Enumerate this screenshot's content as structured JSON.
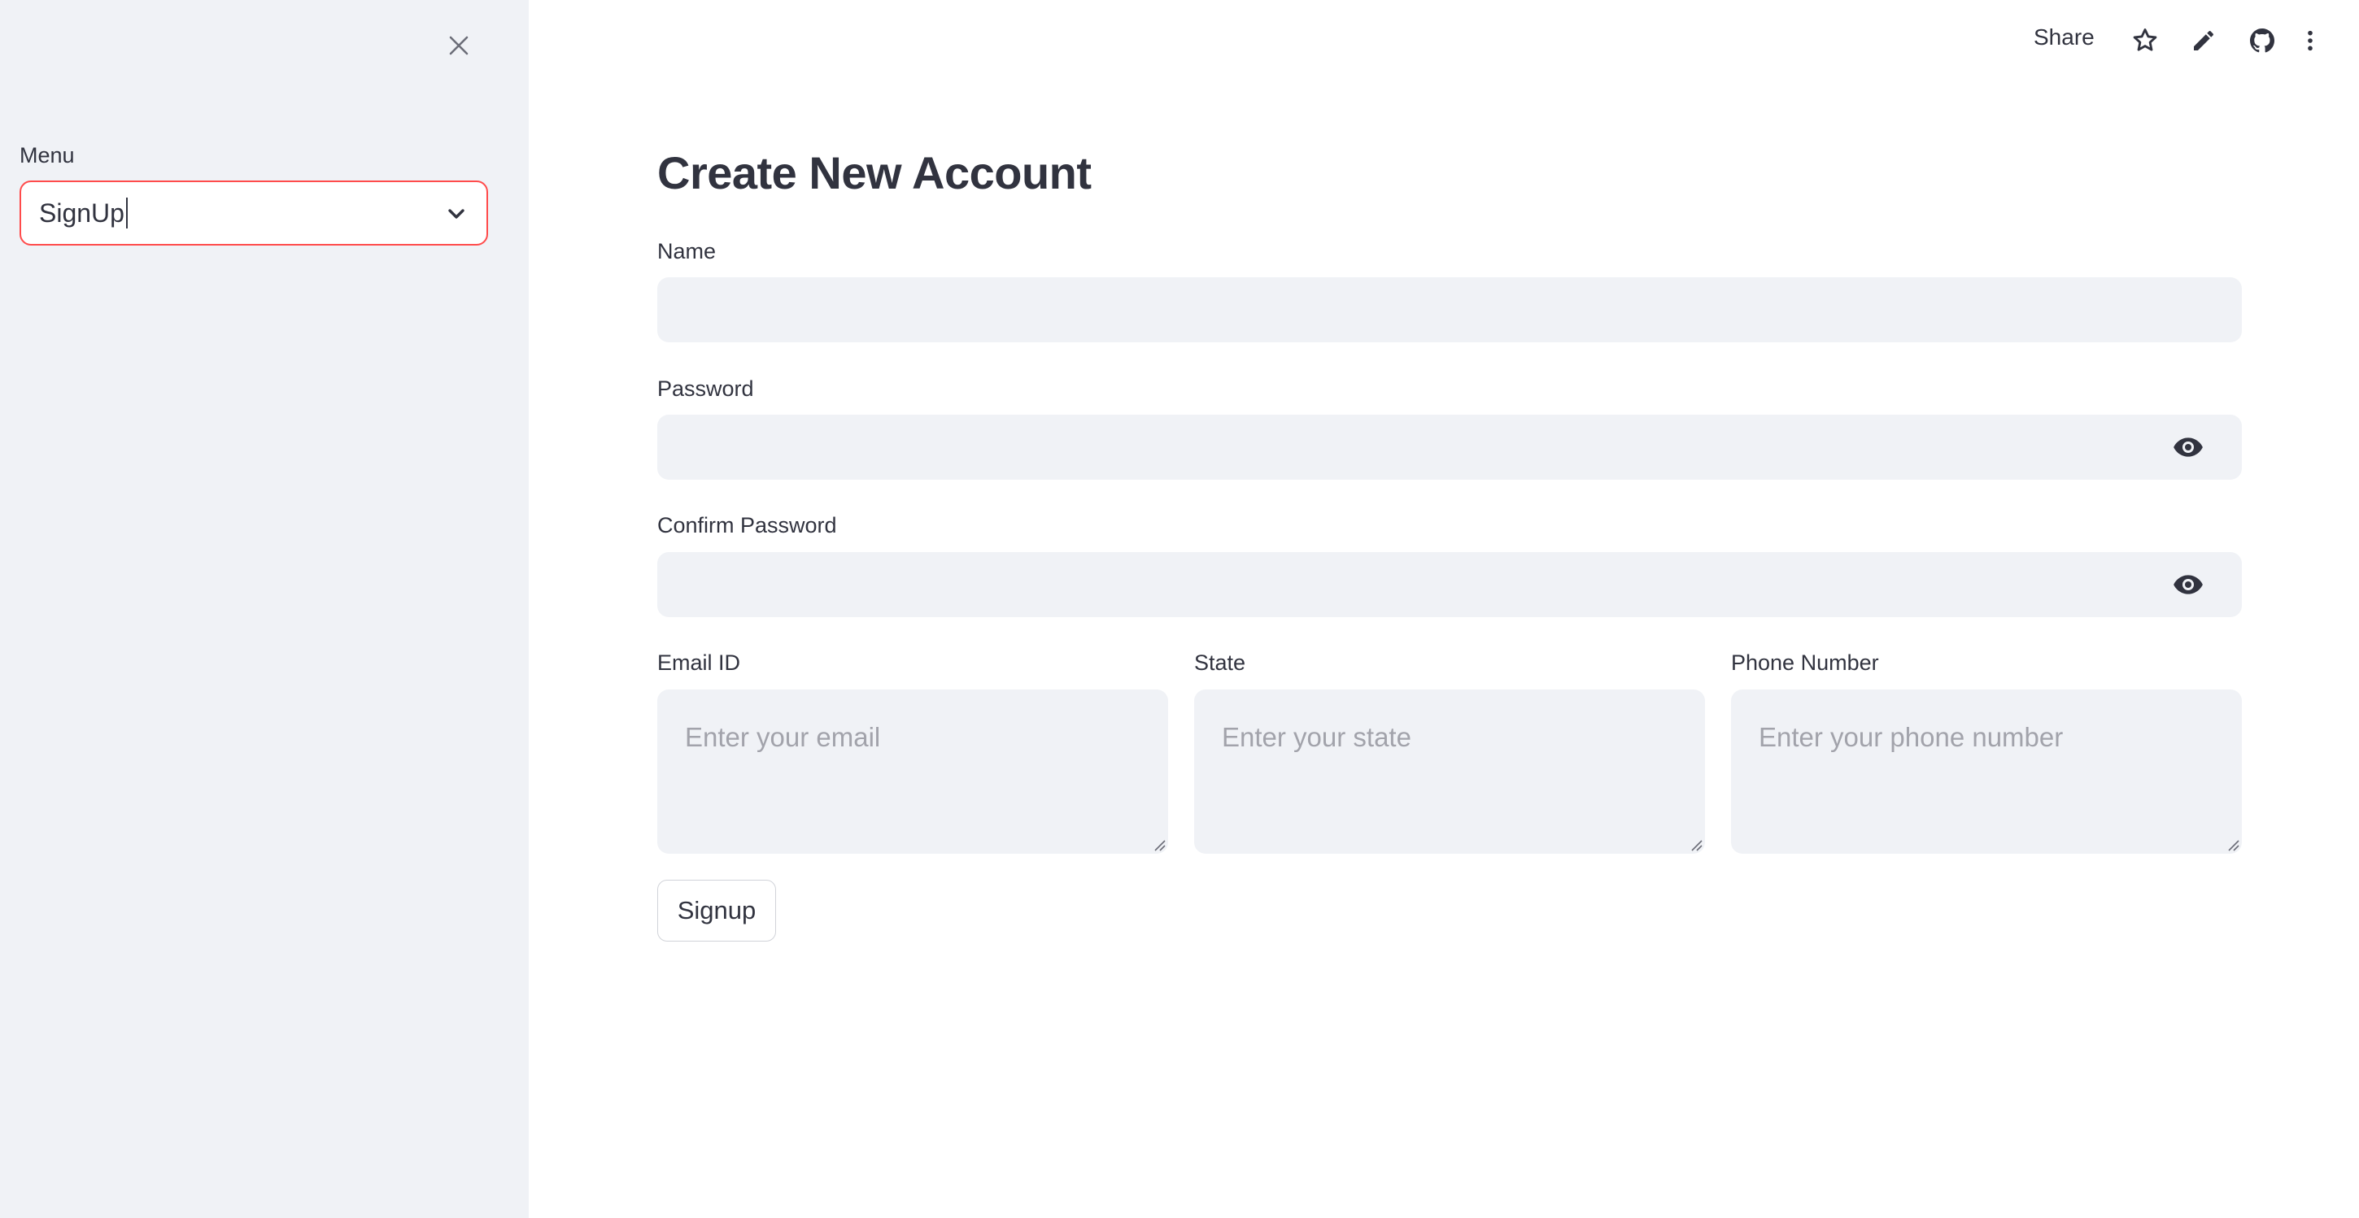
{
  "sidebar": {
    "menu_label": "Menu",
    "menu_value": "SignUp",
    "accent_color": "#ff4b4b"
  },
  "header": {
    "share_label": "Share",
    "icons": [
      "star-icon",
      "pencil-icon",
      "github-icon",
      "more-vertical-icon"
    ]
  },
  "main": {
    "title": "Create New Account",
    "name_label": "Name",
    "password_label": "Password",
    "confirm_password_label": "Confirm Password",
    "email_label": "Email ID",
    "email_placeholder": "Enter your email",
    "state_label": "State",
    "state_placeholder": "Enter your state",
    "phone_label": "Phone Number",
    "phone_placeholder": "Enter your phone number",
    "signup_label": "Signup"
  },
  "colors": {
    "sidebar_bg": "#f0f2f6",
    "input_bg": "#f0f2f6",
    "text": "#31333f",
    "placeholder": "#a2a3ab"
  }
}
